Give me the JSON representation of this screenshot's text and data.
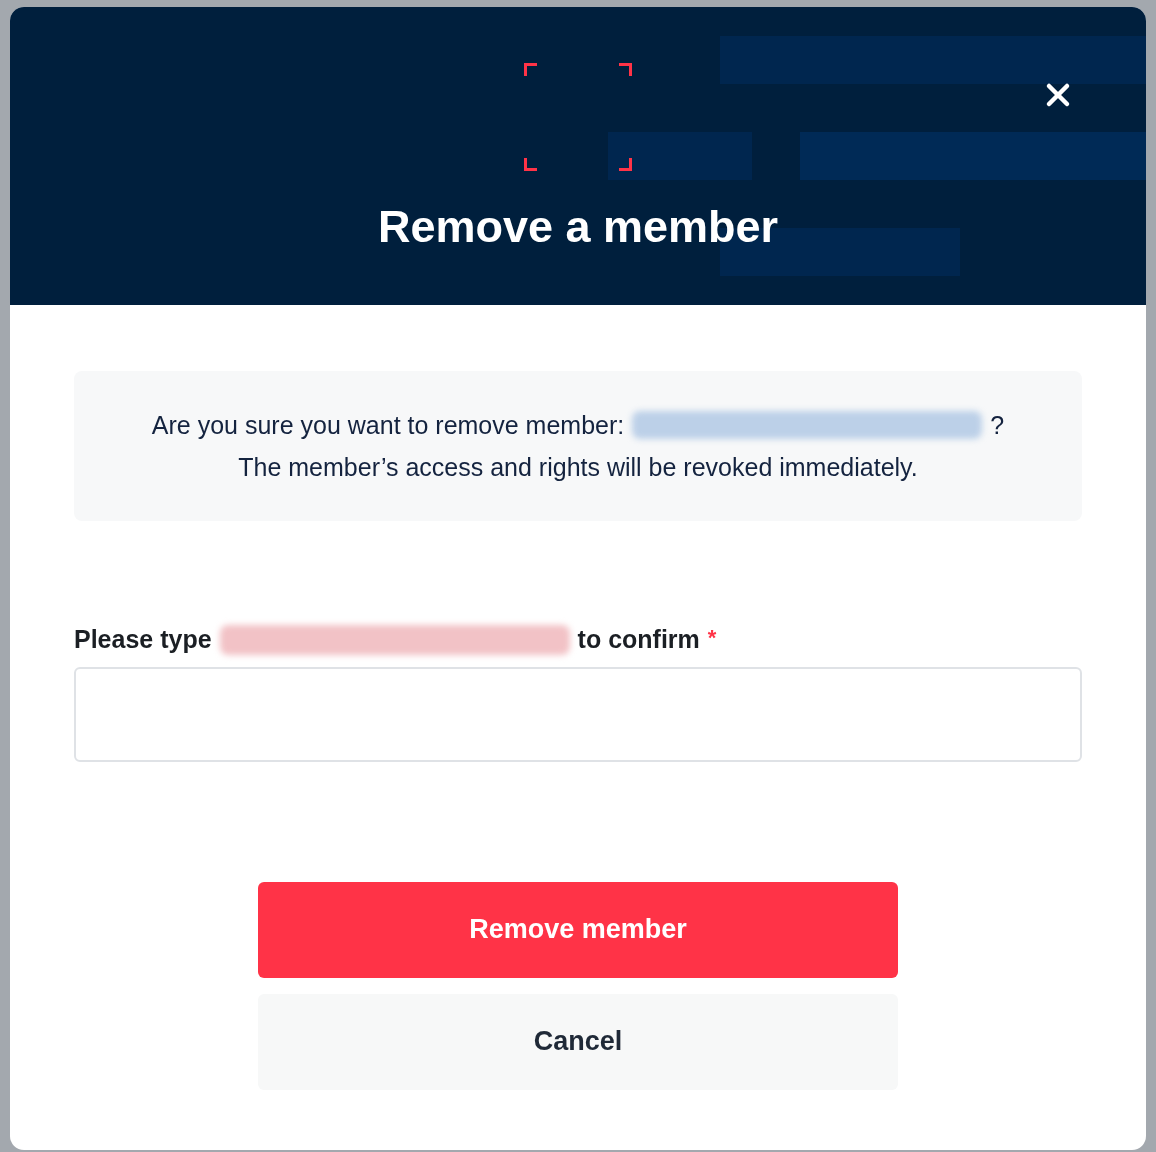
{
  "dialog": {
    "title": "Remove a member",
    "message": {
      "prefix": "Are you sure you want to remove member:",
      "suffix": "?",
      "line2": "The member’s access and rights will be revoked immediately."
    },
    "confirm": {
      "label_prefix": "Please type",
      "label_suffix": "to confirm",
      "required": true,
      "required_mark": "*"
    },
    "buttons": [
      {
        "label": "Remove member",
        "kind": "danger"
      },
      {
        "label": "Cancel",
        "kind": "secondary"
      }
    ]
  }
}
